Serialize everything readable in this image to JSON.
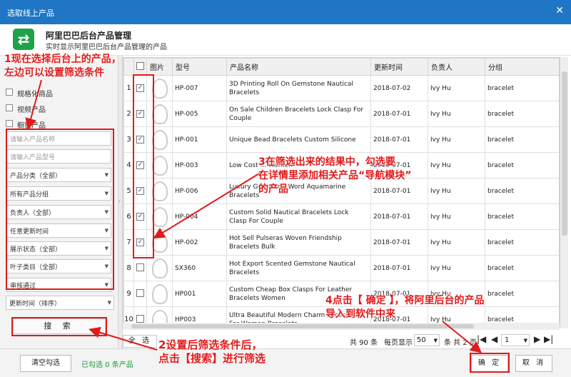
{
  "window": {
    "title": "选取线上产品"
  },
  "header": {
    "title": "阿里巴巴后台产品管理",
    "subtitle": "实时显示阿里巴巴后台产品管理的产品"
  },
  "left": {
    "checkboxes": [
      {
        "label": "规格化商品"
      },
      {
        "label": "视频产品"
      },
      {
        "label": "橱窗产品"
      }
    ],
    "name_placeholder": "请输入产品名称",
    "model_placeholder": "请输入产品型号",
    "filters": [
      "产品分类（全部）",
      "所有产品分组",
      "负责人（全部）",
      "任意更新时间",
      "展示状态（全部）",
      "叶子类目（全部）",
      "审核通过"
    ],
    "sort": "更新时间（排序）",
    "search_label": "搜 索"
  },
  "table": {
    "headers": [
      "",
      "",
      "图片",
      "型号",
      "产品名称",
      "更新时间",
      "负责人",
      "分组"
    ],
    "rows": [
      {
        "n": "1",
        "checked": true,
        "model": "HP-007",
        "name": "3D Printing Roll On Gemstone Nautical Bracelets",
        "updated": "2018-07-02",
        "owner": "Ivy Hu",
        "group": "bracelet"
      },
      {
        "n": "2",
        "checked": true,
        "model": "HP-005",
        "name": "On Sale Children Bracelets Lock Clasp For Couple",
        "updated": "2018-07-01",
        "owner": "Ivy Hu",
        "group": "bracelet"
      },
      {
        "n": "3",
        "checked": true,
        "model": "HP-001",
        "name": "Unique Bead Bracelets Custom Silicone",
        "updated": "2018-07-01",
        "owner": "Ivy Hu",
        "group": "bracelet"
      },
      {
        "n": "4",
        "checked": true,
        "model": "HP-003",
        "name": "Low Cost ... Women",
        "updated": "2018-07-01",
        "owner": "Ivy Hu",
        "group": "bracelet"
      },
      {
        "n": "5",
        "checked": true,
        "model": "HP-006",
        "name": "Luxury Gemstone Word Aquamarine Bracelets",
        "updated": "2018-07-01",
        "owner": "Ivy Hu",
        "group": "bracelet"
      },
      {
        "n": "6",
        "checked": true,
        "model": "HP-004",
        "name": "Custom Solid Nautical Bracelets Lock Clasp For Couple",
        "updated": "2018-07-01",
        "owner": "Ivy Hu",
        "group": "bracelet"
      },
      {
        "n": "7",
        "checked": true,
        "model": "HP-002",
        "name": "Hot Sell Pulseras Woven Friendship Bracelets Bulk",
        "updated": "2018-07-01",
        "owner": "Ivy Hu",
        "group": "bracelet"
      },
      {
        "n": "8",
        "checked": false,
        "model": "SX360",
        "name": "Hot Export Scented Gemstone Nautical Bracelets",
        "updated": "2018-07-01",
        "owner": "Ivy Hu",
        "group": "bracelet"
      },
      {
        "n": "9",
        "checked": false,
        "model": "HP001",
        "name": "Custom Cheap Box Clasps For Leather Bracelets Women",
        "updated": "2018-07-01",
        "owner": "Ivy Hu",
        "group": "bracelet"
      },
      {
        "n": "10",
        "checked": false,
        "model": "HP003",
        "name": "Ultra Beautiful Modern Charm Accessories For Women Bracelets",
        "updated": "2018-07-01",
        "owner": "Ivy Hu",
        "group": "bracelet"
      }
    ]
  },
  "pager": {
    "select_all": "全 选",
    "total": "共 90 条",
    "per_page_label": "每页显示",
    "per_page": "50",
    "unit_total": "条 共 2 页",
    "page": "1"
  },
  "footer": {
    "clear": "清空勾选",
    "selected_status": "已勾选 0 条产品",
    "ok": "确 定",
    "cancel": "取 消"
  },
  "annotations": {
    "a1_line1": "1现在选择后台上的产品，",
    "a1_line2": "左边可以设置筛选条件",
    "a2_line1": "2设置后筛选条件后，",
    "a2_line2": "点击【搜索】进行筛选",
    "a3_line1": "3在筛选出来的结果中，勾选要",
    "a3_line2": "在详情里添加相关产品“导航模块”",
    "a3_line3": "的产品",
    "a4_line1": "4点击【 确定 】，将阿里后台的产品",
    "a4_line2": "导入到软件中来"
  },
  "colors": {
    "titlebar": "#1f76c4",
    "logo": "#1fa34a",
    "annotation": "#e11a1a",
    "status": "#1a9a3a"
  }
}
